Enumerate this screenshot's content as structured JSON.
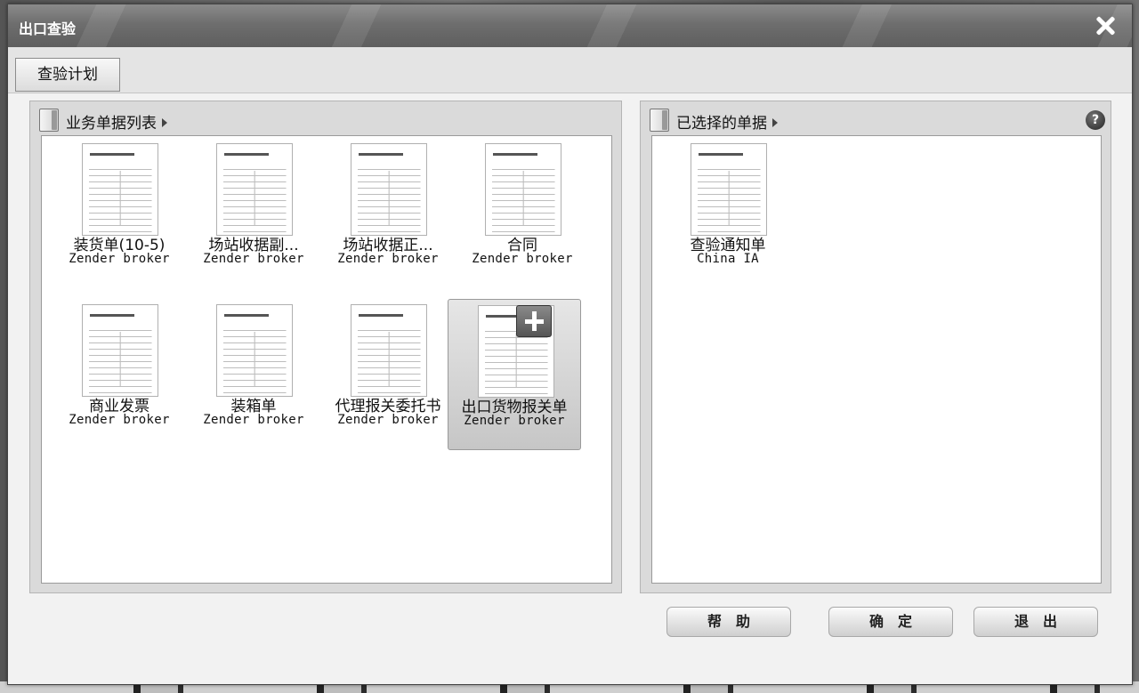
{
  "window": {
    "title": "出口查验"
  },
  "tabs": [
    {
      "label": "查验计划"
    }
  ],
  "left_panel": {
    "title": "业务单据列表",
    "documents": [
      {
        "name": "装货单(10-5)",
        "owner": "Zender broker"
      },
      {
        "name": "场站收据副...",
        "owner": "Zender broker"
      },
      {
        "name": "场站收据正...",
        "owner": "Zender broker"
      },
      {
        "name": "合同",
        "owner": "Zender broker"
      },
      {
        "name": "商业发票",
        "owner": "Zender broker"
      },
      {
        "name": "装箱单",
        "owner": "Zender broker"
      },
      {
        "name": "代理报关委托书",
        "owner": "Zender broker"
      },
      {
        "name": "出口货物报关单",
        "owner": "Zender broker",
        "selected": true
      }
    ]
  },
  "right_panel": {
    "title": "已选择的单据",
    "help_icon": "question-mark-icon",
    "documents": [
      {
        "name": "查验通知单",
        "owner": "China IA"
      }
    ]
  },
  "buttons": {
    "help": "帮助",
    "ok": "确定",
    "exit": "退出"
  },
  "icons": {
    "close": "close-icon",
    "add": "plus-icon",
    "panel": "book-icon"
  }
}
